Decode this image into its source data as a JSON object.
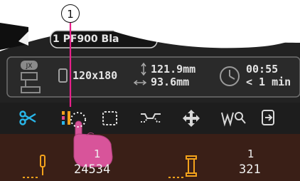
{
  "callout": {
    "number": "1"
  },
  "header": {
    "model_label": "1 PF900  Bla"
  },
  "info": {
    "badge": "JX",
    "size": "120x180",
    "height": "121.9mm",
    "width": "93.6mm",
    "time": "00:55",
    "remaining": "< 1 min"
  },
  "toolbar": {
    "items": [
      {
        "icon": "scissors-icon"
      },
      {
        "icon": "color-sort-icon"
      },
      {
        "icon": "selection-frame-icon"
      },
      {
        "icon": "jump-stitch-icon"
      },
      {
        "icon": "move-icon"
      },
      {
        "icon": "stitch-search-icon"
      },
      {
        "icon": "exit-icon"
      }
    ]
  },
  "counters": {
    "stitch_index": "1",
    "stitch_total": "24534",
    "color_index": "1",
    "color_total": "321"
  },
  "colors": {
    "panel_bg": "#222222",
    "toolbar_bg": "#1d1d1d",
    "footer_bg": "#3a1f17",
    "accent_cyan": "#29b6e9",
    "accent_orange": "#f3a21c",
    "hand_pink": "#d8549a",
    "callout_line": "#e8208a"
  }
}
